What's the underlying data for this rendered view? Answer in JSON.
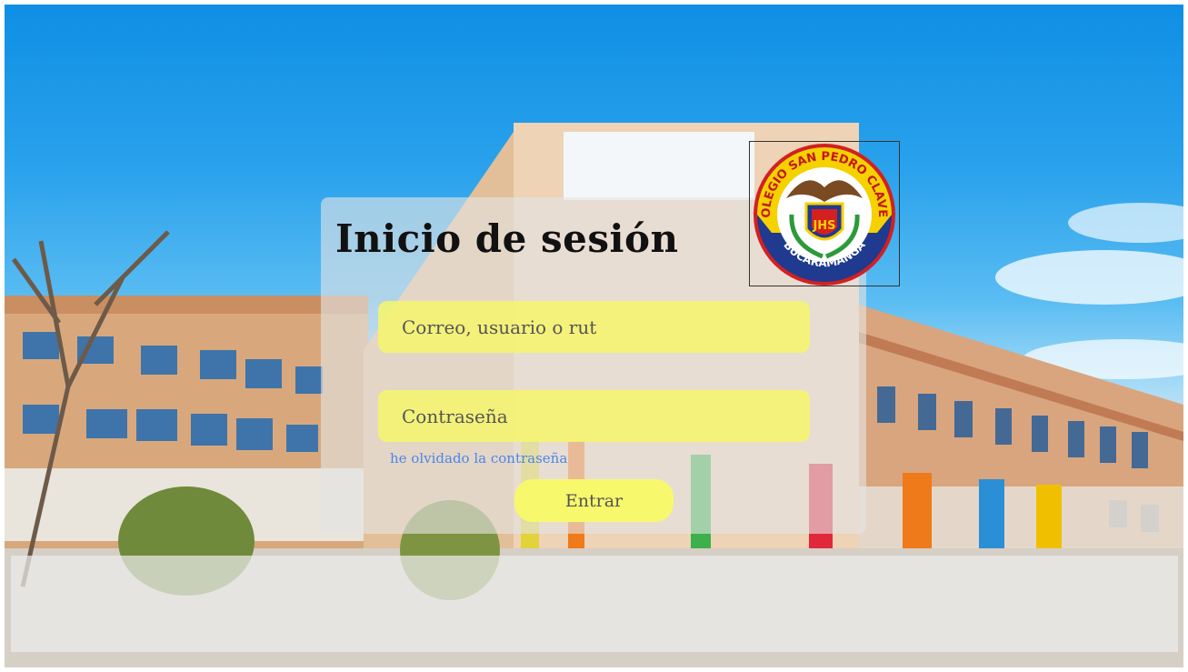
{
  "login": {
    "title": "Inicio de sesión",
    "user_placeholder": "Correo, usuario o rut",
    "password_placeholder": "Contraseña",
    "forgot_label": "he olvidado la contraseña",
    "submit_label": "Entrar"
  },
  "logo": {
    "top_text": "COLEGIO SAN PEDRO CLAVER",
    "bottom_text": "BUCARAMANGA",
    "monogram": "JHS"
  },
  "colors": {
    "field_fill": "#f5f56e",
    "button_fill": "#f8f86c",
    "link": "#4a86e8",
    "logo_blue": "#1f3a8f",
    "logo_yellow": "#f5d100",
    "logo_red": "#d42020"
  }
}
